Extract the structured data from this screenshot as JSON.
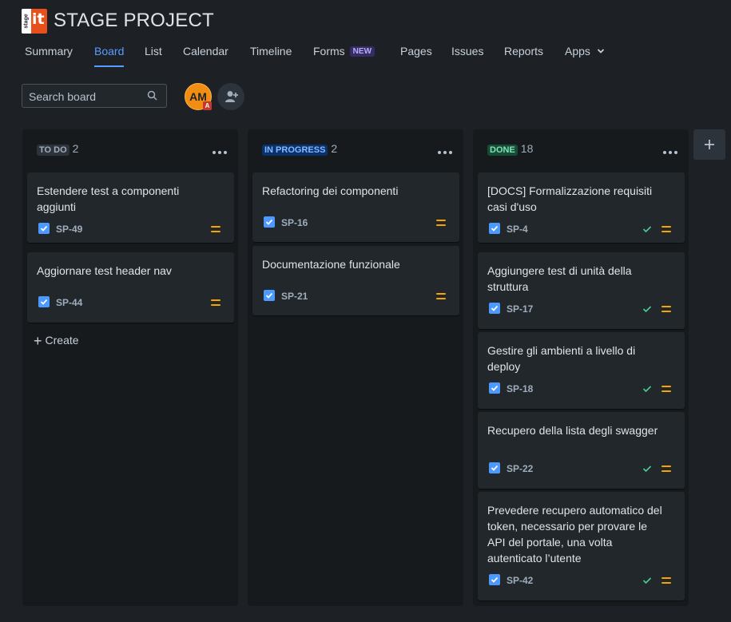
{
  "project": {
    "logo_stage_text": "stage",
    "logo_it_text": "it",
    "title": "STAGE PROJECT"
  },
  "tabs": [
    {
      "label": "Summary"
    },
    {
      "label": "Board",
      "active": true
    },
    {
      "label": "List"
    },
    {
      "label": "Calendar"
    },
    {
      "label": "Timeline"
    },
    {
      "label": "Forms",
      "badge": "NEW"
    },
    {
      "label": "Pages"
    },
    {
      "label": "Issues"
    },
    {
      "label": "Reports"
    },
    {
      "label": "Apps"
    }
  ],
  "search": {
    "placeholder": "Search board"
  },
  "avatar": {
    "initials": "AM",
    "mini": "A"
  },
  "columns": [
    {
      "name": "TO DO",
      "count": "2",
      "lozenge_bg": "#2c333a",
      "lozenge_fg": "#9fadbc",
      "cards": [
        {
          "title": "Estendere test a componenti aggiunti",
          "key": "SP-49"
        },
        {
          "title": "Aggiornare test header nav",
          "key": "SP-44"
        }
      ],
      "create_label": "Create"
    },
    {
      "name": "IN PROGRESS",
      "count": "2",
      "lozenge_bg": "#09326c",
      "lozenge_fg": "#85b8ff",
      "cards": [
        {
          "title": "Refactoring dei componenti",
          "key": "SP-16"
        },
        {
          "title": "Documentazione funzionale",
          "key": "SP-21"
        }
      ]
    },
    {
      "name": "DONE",
      "count": "18",
      "lozenge_bg": "#164b35",
      "lozenge_fg": "#7ee2b8",
      "cards": [
        {
          "title": "[DOCS] Formalizzazione requisiti casi d'uso",
          "key": "SP-4"
        },
        {
          "title": "Aggiungere test di unità della struttura",
          "key": "SP-17"
        },
        {
          "title": "Gestire gli ambienti a livello di deploy",
          "key": "SP-18"
        },
        {
          "title": "Recupero della lista degli swagger",
          "key": "SP-22"
        },
        {
          "title": "Prevedere recupero automatico del token, necessario per provare le API del portale, una volta autenticato l’utente",
          "key": "SP-42"
        }
      ]
    }
  ],
  "colors": {
    "accent": "#579dff",
    "priority": "#f8a400",
    "done_check": "#4bce97",
    "checkbox": "#4c9aff"
  }
}
